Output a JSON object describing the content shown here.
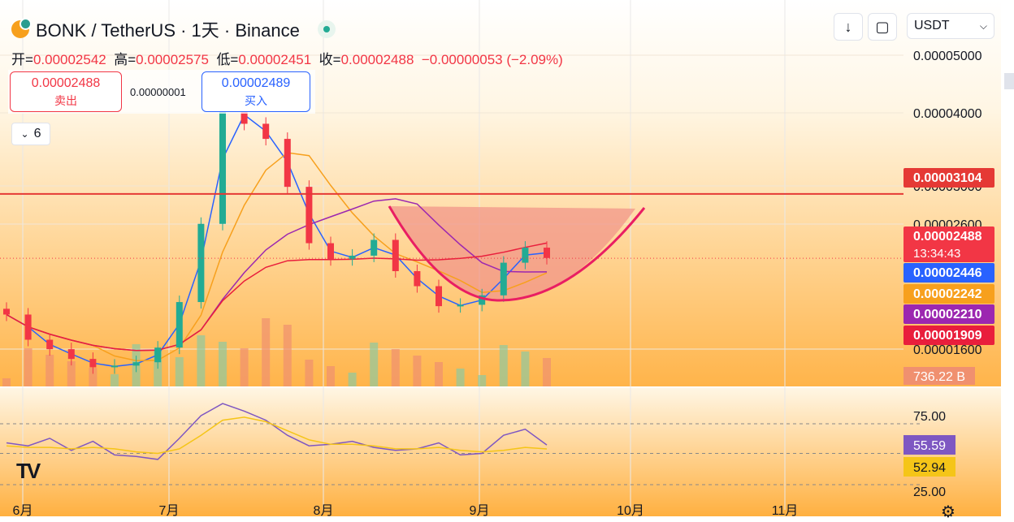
{
  "header": {
    "symbol_title": "BONK / TetherUS · 1天 · Binance",
    "ohlc": {
      "open_label": "开=",
      "open": "0.00002542",
      "high_label": "高=",
      "high": "0.00002575",
      "low_label": "低=",
      "low": "0.00002451",
      "close_label": "收=",
      "close": "0.00002488",
      "change": "−0.00000053 (−2.09%)"
    }
  },
  "trade": {
    "sell_price": "0.00002488",
    "sell_label": "卖出",
    "spread": "0.00000001",
    "buy_price": "0.00002489",
    "buy_label": "买入"
  },
  "indicators_toggle": {
    "count": "6"
  },
  "toolbar": {
    "currency": "USDT"
  },
  "colors": {
    "up": "#22ab94",
    "down": "#f23645",
    "ma_fast": "#2962ff",
    "ma_mid": "#f7a01d",
    "ma_slow": "#9c27b0",
    "ma_long": "#e91e3c",
    "resistance": "#e53935",
    "cup": "#e91e63",
    "rsi": "#7e57c2",
    "rsi_ma": "#f5c518"
  },
  "chart_data": [
    {
      "type": "candlestick",
      "title": "BONK / TetherUS · 1天 · Binance",
      "x_ticks": [
        "6月",
        "7月",
        "8月",
        "9月",
        "10月",
        "11月"
      ],
      "y_ticks": [
        "0.00005000",
        "0.00004000",
        "0.00003000",
        "0.00002600",
        "0.00001600"
      ],
      "scale": "log",
      "ylim": [
        1.53e-05,
        5.6e-05
      ],
      "candles_close_sample": [
        2.05e-05,
        1.88e-05,
        1.82e-05,
        1.76e-05,
        1.71e-05,
        1.72e-05,
        1.74e-05,
        1.83e-05,
        2.14e-05,
        2.8e-05,
        4.2e-05,
        3.95e-05,
        3.75e-05,
        3.18e-05,
        2.62e-05,
        2.48e-05,
        2.51e-05,
        2.65e-05,
        2.38e-05,
        2.26e-05,
        2.11e-05,
        2.12e-05,
        2.19e-05,
        2.45e-05,
        2.58e-05,
        2.49e-05
      ],
      "resistance_line": 3.104e-05,
      "price_labels": [
        {
          "name": "resistance",
          "value": "0.00003104"
        },
        {
          "name": "last",
          "value": "0.00002488",
          "countdown": "13:34:43"
        },
        {
          "name": "ma_fast",
          "value": "0.00002446"
        },
        {
          "name": "ma_mid",
          "value": "0.00002242"
        },
        {
          "name": "ma_slow",
          "value": "0.00002210"
        },
        {
          "name": "ma_long",
          "value": "0.00001909"
        }
      ],
      "volume_label": "736.22 B"
    },
    {
      "type": "line",
      "series": [
        {
          "values": [
            57,
            55,
            60,
            52,
            58,
            49,
            48,
            46,
            60,
            75,
            83,
            78,
            72,
            62,
            55,
            56,
            58,
            54,
            52,
            53,
            57,
            49,
            50,
            62,
            66,
            55.59
          ]
        },
        {
          "values": [
            55,
            54,
            54,
            53,
            54,
            53,
            51,
            50,
            53,
            62,
            72,
            74,
            71,
            65,
            59,
            56,
            56,
            55,
            53,
            53,
            54,
            52,
            51,
            52,
            54,
            52.94
          ]
        }
      ],
      "y_ticks": [
        "75.00",
        "25.00"
      ],
      "labels": [
        "55.59",
        "52.94"
      ]
    }
  ]
}
